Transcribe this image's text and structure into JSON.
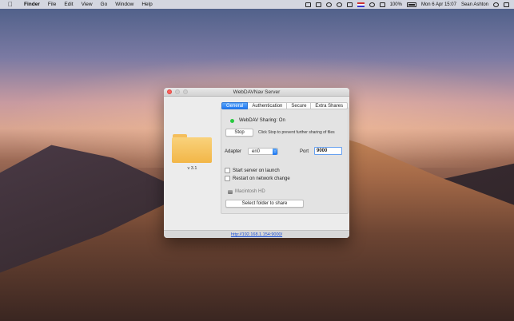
{
  "menubar": {
    "app_name": "Finder",
    "items": [
      "File",
      "Edit",
      "View",
      "Go",
      "Window",
      "Help"
    ],
    "status": {
      "battery": "100%",
      "datetime": "Mon 6 Apr 15:07",
      "user": "Sean Ashton"
    }
  },
  "window": {
    "title": "WebDAVNav Server",
    "version": "v 3.1",
    "tabs": [
      {
        "label": "General",
        "active": true
      },
      {
        "label": "Authentication",
        "active": false
      },
      {
        "label": "Secure",
        "active": false
      },
      {
        "label": "Extra Shares",
        "active": false
      }
    ],
    "status_text": "WebDAV Sharing: On",
    "status_color": "#27c93f",
    "stop_button": "Stop",
    "stop_hint": "Click Stop to prevent further sharing of files",
    "adapter_label": "Adapter",
    "adapter_value": "en0",
    "port_label": "Port",
    "port_value": "9000",
    "checkbox_start": "Start server on launch",
    "checkbox_restart": "Restart on network change",
    "disk_label": "Macintosh HD",
    "select_folder_button": "Select folder to share",
    "url": "http://192.168.1.154:9000/"
  }
}
